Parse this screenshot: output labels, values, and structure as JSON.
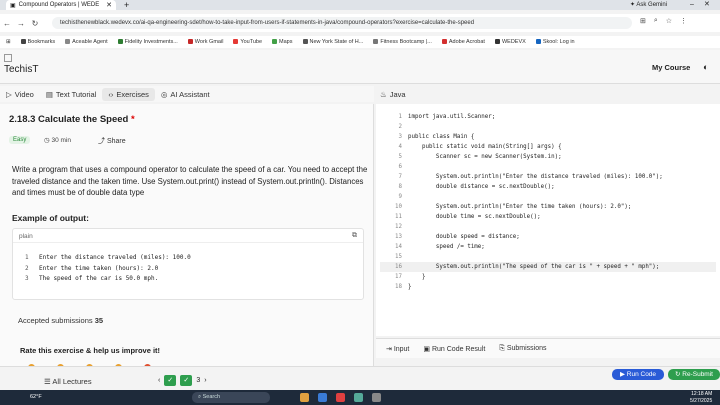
{
  "browser": {
    "tab_title": "Compound Operators | WEDE",
    "ask_gemini": "Ask Gemini",
    "url": "techisthenewblack.wedevx.co/ai-qa-engineering-sdet/how-to-take-input-from-users-if-statements-in-java/compound-operators?exercise=calculate-the-speed",
    "bookmarks": [
      {
        "label": "Bookmarks",
        "color": "#444444"
      },
      {
        "label": "Aceable Agent",
        "color": "#888888"
      },
      {
        "label": "Fidelity Investments...",
        "color": "#2e7d32"
      },
      {
        "label": "Work Gmail",
        "color": "#c62828"
      },
      {
        "label": "YouTube",
        "color": "#e53935"
      },
      {
        "label": "Maps",
        "color": "#43a047"
      },
      {
        "label": "New York State of H...",
        "color": "#555555"
      },
      {
        "label": "Fitness Bootcamp |...",
        "color": "#777777"
      },
      {
        "label": "Adobe Acrobat",
        "color": "#d32f2f"
      },
      {
        "label": "WEDEVX",
        "color": "#333333"
      },
      {
        "label": "Skool: Log in",
        "color": "#1565c0"
      }
    ]
  },
  "site": {
    "logo": "TechisT",
    "my_course": "My Course"
  },
  "left_tabs": [
    {
      "label": "Video",
      "icon": "play-icon"
    },
    {
      "label": "Text Tutorial",
      "icon": "document-icon"
    },
    {
      "label": "Exercises",
      "icon": "code-icon"
    },
    {
      "label": "AI Assistant",
      "icon": "ai-icon"
    }
  ],
  "exercise": {
    "title": "2.18.3 Calculate the Speed",
    "required_mark": "*",
    "difficulty": "Easy",
    "duration": "30 min",
    "share": "Share",
    "description": "Write a program that uses a compound operator to calculate the speed of a car. You need to accept the traveled distance and the taken time. Use System.out.print() instead of System.out.println(). Distances and times must be of double data type",
    "example_title": "Example of output:",
    "example_lang": "plain",
    "example_lines": [
      {
        "num": "1",
        "text": "Enter the distance traveled (miles): 100.0"
      },
      {
        "num": "2",
        "text": "Enter the time taken (hours): 2.0"
      },
      {
        "num": "3",
        "text": "The speed of the car is 50.0 mph."
      }
    ],
    "accepted_label": "Accepted submissions",
    "accepted_count": "35",
    "rate_label": "Rate this exercise & help us improve it!"
  },
  "editor": {
    "language": "Java",
    "lines": [
      {
        "num": "1",
        "code": "import java.util.Scanner;"
      },
      {
        "num": "2",
        "code": ""
      },
      {
        "num": "3",
        "code": "public class Main {"
      },
      {
        "num": "4",
        "code": "    public static void main(String[] args) {"
      },
      {
        "num": "5",
        "code": "        Scanner sc = new Scanner(System.in);"
      },
      {
        "num": "6",
        "code": ""
      },
      {
        "num": "7",
        "code": "        System.out.println(\"Enter the distance traveled (miles): 100.0\");"
      },
      {
        "num": "8",
        "code": "        double distance = sc.nextDouble();"
      },
      {
        "num": "9",
        "code": ""
      },
      {
        "num": "10",
        "code": "        System.out.println(\"Enter the time taken (hours): 2.0\");"
      },
      {
        "num": "11",
        "code": "        double time = sc.nextDouble();"
      },
      {
        "num": "12",
        "code": ""
      },
      {
        "num": "13",
        "code": "        double speed = distance;"
      },
      {
        "num": "14",
        "code": "        speed /= time;"
      },
      {
        "num": "15",
        "code": ""
      },
      {
        "num": "16",
        "code": "        System.out.println(\"The speed of the car is \" + speed + \" mph\");"
      },
      {
        "num": "17",
        "code": "    }"
      },
      {
        "num": "18",
        "code": "}"
      }
    ],
    "highlighted_line": "16",
    "bottom_tabs": [
      {
        "label": "Input",
        "icon": "input-icon"
      },
      {
        "label": "Run Code Result",
        "icon": "result-icon"
      },
      {
        "label": "Submissions",
        "icon": "submissions-icon"
      }
    ]
  },
  "footer": {
    "all_lectures": "All Lectures",
    "page": "3",
    "run_code": "Run Code",
    "resubmit": "Re-Submit"
  },
  "taskbar": {
    "weather": "62°F",
    "search": "Search",
    "time": "12:18 AM",
    "date": "5/27/2025"
  }
}
